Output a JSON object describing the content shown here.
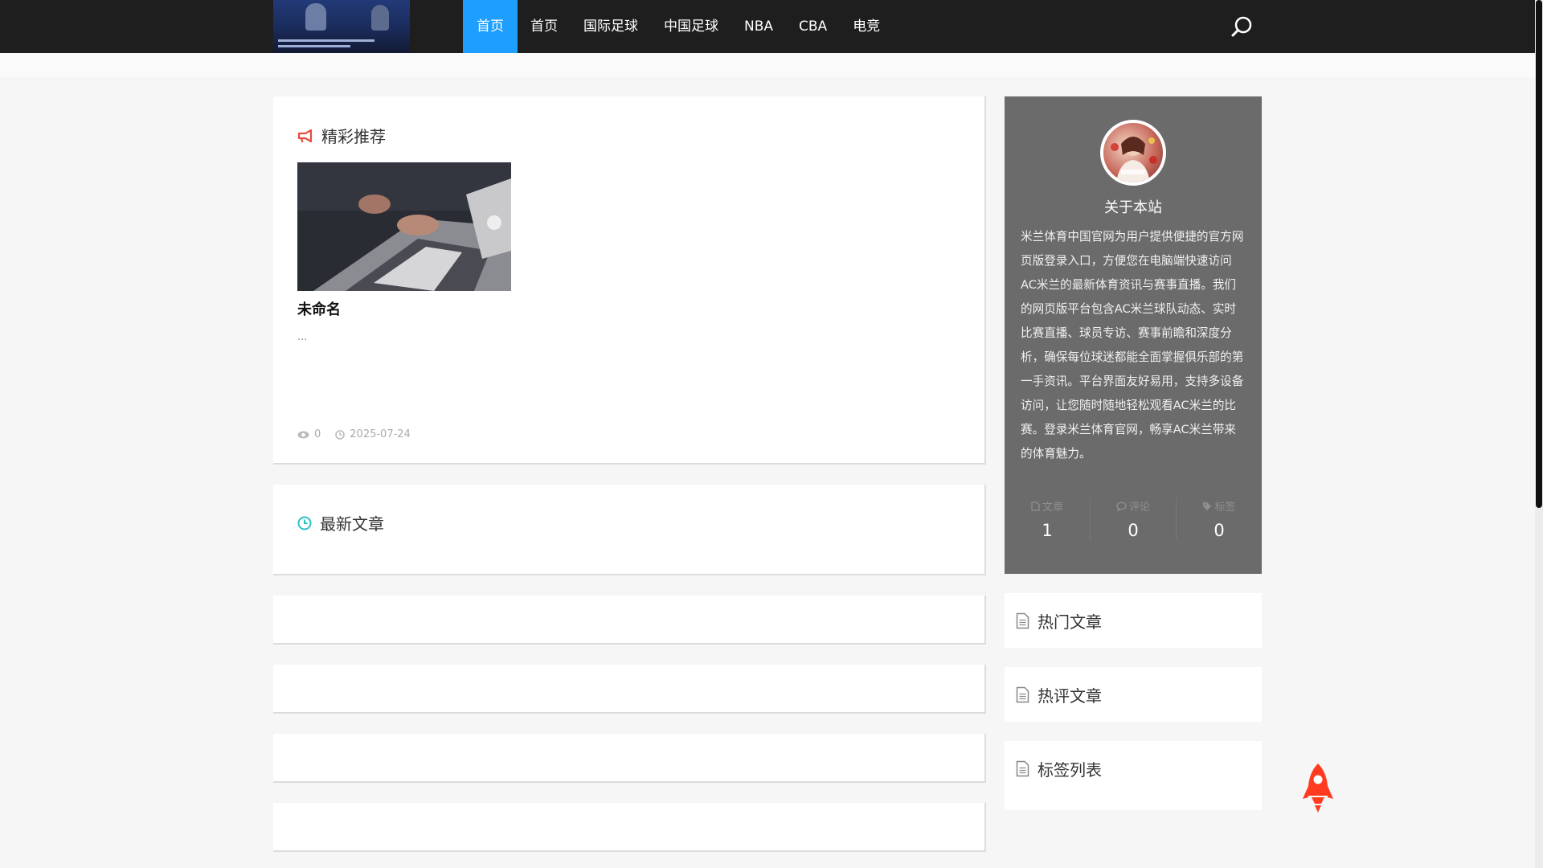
{
  "header": {
    "nav": [
      "首页",
      "首页",
      "国际足球",
      "中国足球",
      "NBA",
      "CBA",
      "电竞"
    ]
  },
  "featured": {
    "title": "精彩推荐",
    "article": {
      "title": "未命名",
      "excerpt": "...",
      "views": "0",
      "date": "2025-07-24"
    }
  },
  "latest": {
    "title": "最新文章"
  },
  "about": {
    "title": "关于本站",
    "text": "米兰体育中国官网为用户提供便捷的官方网页版登录入口，方便您在电脑端快速访问AC米兰的最新体育资讯与赛事直播。我们的网页版平台包含AC米兰球队动态、实时比赛直播、球员专访、赛事前瞻和深度分析，确保每位球迷都能全面掌握俱乐部的第一手资讯。平台界面友好易用，支持多设备访问，让您随时随地轻松观看AC米兰的比赛。登录米兰体育官网，畅享AC米兰带来的体育魅力。",
    "stats": [
      {
        "label": "文章",
        "value": "1"
      },
      {
        "label": "评论",
        "value": "0"
      },
      {
        "label": "标签",
        "value": "0"
      }
    ]
  },
  "sidebar": {
    "hot": "热门文章",
    "hot_comments": "热评文章",
    "tags": "标签列表"
  },
  "colors": {
    "nav_active": "#1e9fff",
    "megaphone": "#e74c3c",
    "clock": "#2bc0c5",
    "rocket": "#ff3b1f"
  }
}
